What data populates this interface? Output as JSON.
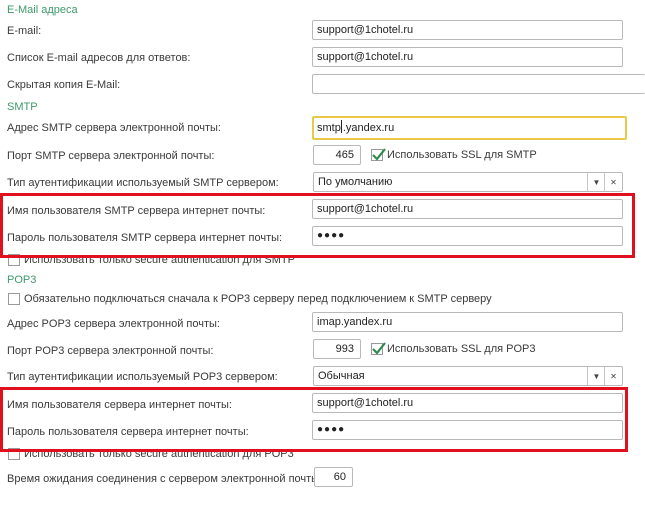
{
  "email_section": {
    "title": "E-Mail адреса",
    "email_label": "E-mail:",
    "email_value": "support@1chotel.ru",
    "reply_label": "Список E-mail адресов для ответов:",
    "reply_value": "support@1chotel.ru",
    "bcc_label": "Скрытая копия E-Mail:",
    "bcc_value": ""
  },
  "smtp": {
    "title": "SMTP",
    "server_label": "Адрес SMTP сервера электронной почты:",
    "server_value_before_cursor": "smtp",
    "server_value_after_cursor": ".yandex.ru",
    "port_label": "Порт SMTP сервера электронной почты:",
    "port_value": "465",
    "ssl_label": "Использовать SSL для SMTP",
    "ssl_checked": true,
    "auth_label": "Тип аутентификации используемый SMTP сервером:",
    "auth_value": "По умолчанию",
    "user_label": "Имя пользователя SMTP сервера интернет почты:",
    "user_value": "support@1chotel.ru",
    "password_label": "Пароль пользователя SMTP сервера интернет почты:",
    "password_value": "●●●●",
    "secure_auth_label": "Использовать только secure authentication для SMTP"
  },
  "pop3": {
    "title": "POP3",
    "connect_first_label": "Обязательно подключаться сначала к POP3 серверу перед подключением к SMTP серверу",
    "server_label": "Адрес POP3 сервера электронной почты:",
    "server_value": "imap.yandex.ru",
    "port_label": "Порт POP3 сервера электронной почты:",
    "port_value": "993",
    "ssl_label": "Использовать SSL для POP3",
    "ssl_checked": true,
    "auth_label": "Тип аутентификации используемый POP3 сервером:",
    "auth_value": "Обычная",
    "user_label": "Имя пользователя сервера интернет почты:",
    "user_value": "support@1chotel.ru",
    "password_label": "Пароль пользователя сервера интернет почты:",
    "password_value": "●●●●",
    "secure_auth_label": "Использовать только secure authentication для POP3"
  },
  "timeout": {
    "label": "Время ожидания соединения с сервером электронной почты:",
    "value": "60"
  },
  "icons": {
    "dropdown": "chevron-down-icon",
    "clear": "close-icon",
    "check": "checkmark-icon"
  },
  "colors": {
    "section_title": "#3d9a6a",
    "highlight_box": "#e0101e",
    "focus_border": "#e9c94a",
    "checkmark": "#2f8a4e"
  }
}
